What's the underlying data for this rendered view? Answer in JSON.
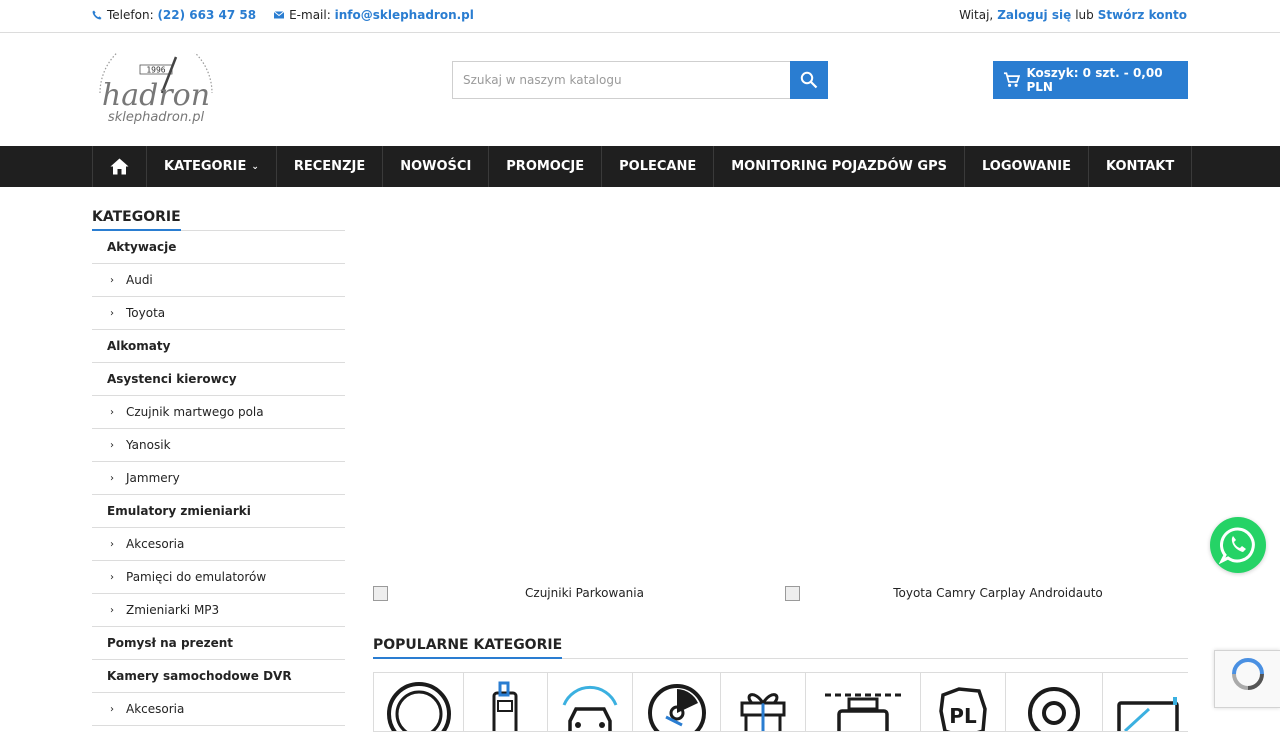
{
  "topbar": {
    "phone_label": "Telefon:",
    "phone_value": "(22) 663 47 58",
    "email_label": "E-mail:",
    "email_value": "info@sklephadron.pl",
    "welcome": "Witaj,",
    "login_link": "Zaloguj się",
    "or": "lub",
    "register_link": "Stwórz konto"
  },
  "header": {
    "logo_year": "1996",
    "logo_brand": "hadron",
    "logo_domain": "sklephadron.pl",
    "search_placeholder": "Szukaj w naszym katalogu",
    "cart_label": "Koszyk: 0 szt. - 0,00 PLN"
  },
  "nav": {
    "items": [
      "KATEGORIE",
      "RECENZJE",
      "NOWOŚCI",
      "PROMOCJE",
      "POLECANE",
      "MONITORING POJAZDÓW GPS",
      "LOGOWANIE",
      "KONTAKT"
    ]
  },
  "sidebar": {
    "title": "KATEGORIE",
    "categories": [
      {
        "label": "Aktywacje",
        "level": "parent"
      },
      {
        "label": "Audi",
        "level": "child"
      },
      {
        "label": "Toyota",
        "level": "child"
      },
      {
        "label": "Alkomaty",
        "level": "parent"
      },
      {
        "label": "Asystenci kierowcy",
        "level": "parent"
      },
      {
        "label": "Czujnik martwego pola",
        "level": "child"
      },
      {
        "label": "Yanosik",
        "level": "child"
      },
      {
        "label": "Jammery",
        "level": "child"
      },
      {
        "label": "Emulatory zmieniarki",
        "level": "parent"
      },
      {
        "label": "Akcesoria",
        "level": "child"
      },
      {
        "label": "Pamięci do emulatorów",
        "level": "child"
      },
      {
        "label": "Zmieniarki MP3",
        "level": "child"
      },
      {
        "label": "Pomysł na prezent",
        "level": "parent"
      },
      {
        "label": "Kamery samochodowe DVR",
        "level": "parent"
      },
      {
        "label": "Akcesoria",
        "level": "child"
      }
    ]
  },
  "main": {
    "banner_left": "Czujniki Parkowania",
    "banner_right": "Toyota Camry Carplay Androidauto",
    "popular_title": "POPULARNE KATEGORIE",
    "tile_pl_text": "PL"
  },
  "colors": {
    "accent": "#2a7dd1",
    "nav_bg": "#1f1f1f",
    "whatsapp": "#25d366"
  }
}
